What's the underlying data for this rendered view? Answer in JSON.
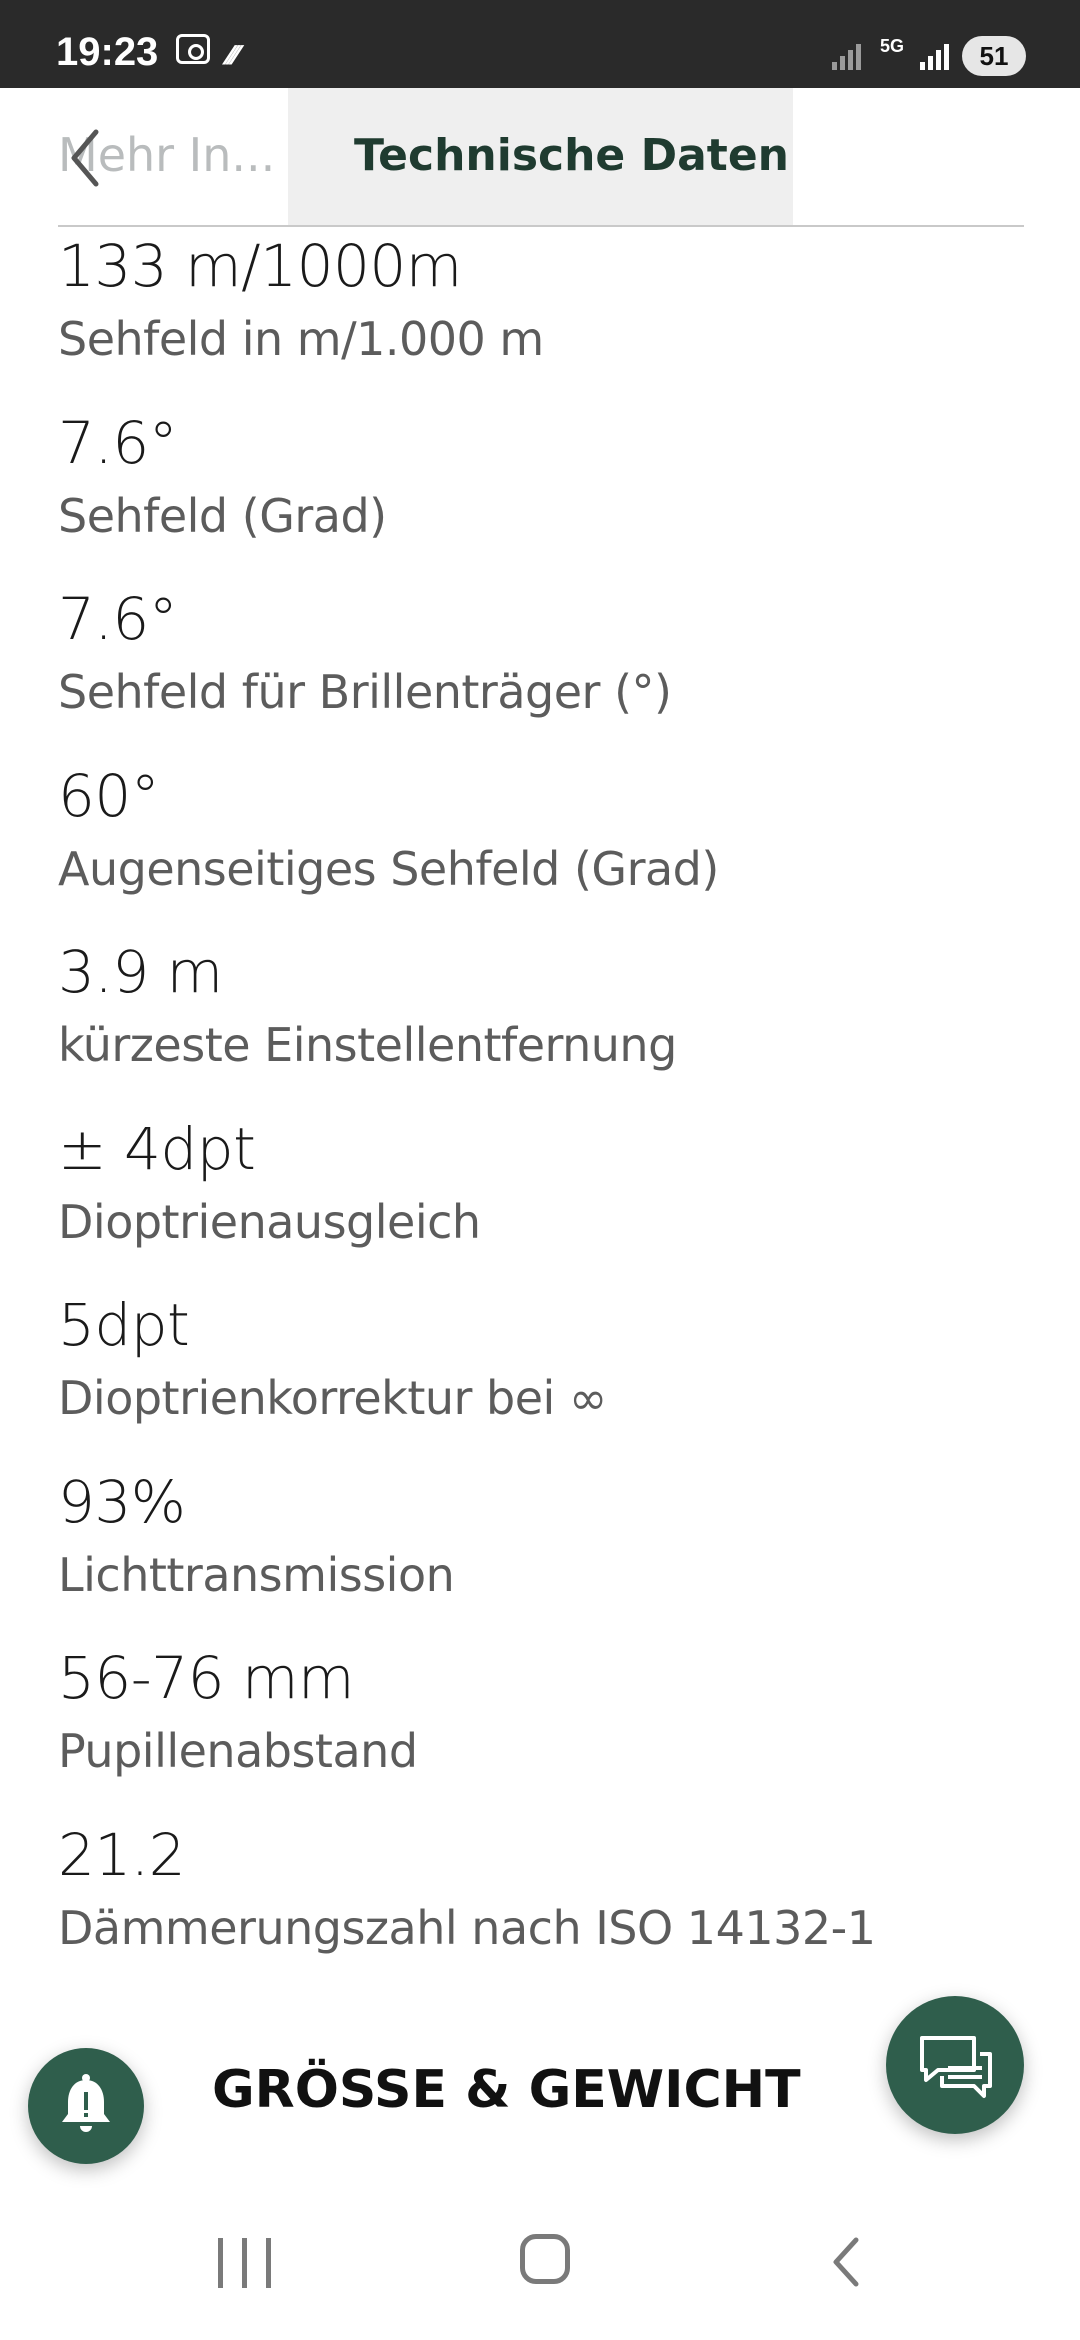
{
  "status_bar": {
    "time": "19:23",
    "network": "5G",
    "battery": "51"
  },
  "header": {
    "prev_tab": "Mehr In...",
    "active_tab": "Technische Daten"
  },
  "specs": [
    {
      "value": "133 m/1000m",
      "label": "Sehfeld in m/1.000 m"
    },
    {
      "value": "7.6°",
      "label": "Sehfeld (Grad)"
    },
    {
      "value": "7.6°",
      "label": "Sehfeld für Brillenträger (°)"
    },
    {
      "value": "60°",
      "label": "Augenseitiges Sehfeld (Grad)"
    },
    {
      "value": "3.9 m",
      "label": "kürzeste Einstellentfernung"
    },
    {
      "value": "± 4dpt",
      "label": "Dioptrienausgleich"
    },
    {
      "value": "5dpt",
      "label": "Dioptrienkorrektur bei ∞"
    },
    {
      "value": "93%",
      "label": "Lichttransmission"
    },
    {
      "value": "56-76 mm",
      "label": "Pupillenabstand"
    },
    {
      "value": "21.2",
      "label": "Dämmerungszahl nach ISO 14132-1"
    }
  ],
  "section": {
    "title": "GRÖSSE & GEWICHT"
  },
  "icons": {
    "back": "chevron-left-icon",
    "bell": "bell-icon",
    "chat": "chat-icon"
  },
  "colors": {
    "accent": "#2f5e4c",
    "tab_text": "#1f3b30",
    "status_bar": "#2a2a2a"
  }
}
